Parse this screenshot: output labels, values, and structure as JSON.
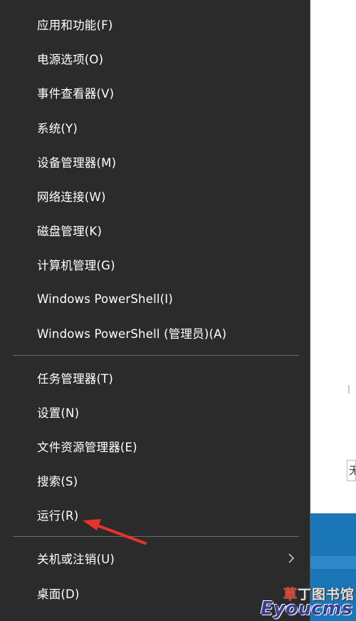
{
  "menu": {
    "items": [
      {
        "label": "应用和功能(F)"
      },
      {
        "label": "电源选项(O)"
      },
      {
        "label": "事件查看器(V)"
      },
      {
        "label": "系统(Y)"
      },
      {
        "label": "设备管理器(M)"
      },
      {
        "label": "网络连接(W)"
      },
      {
        "label": "磁盘管理(K)"
      },
      {
        "label": "计算机管理(G)"
      },
      {
        "label": "Windows PowerShell(I)"
      },
      {
        "label": "Windows PowerShell (管理员)(A)"
      },
      {
        "label": "任务管理器(T)"
      },
      {
        "label": "设置(N)"
      },
      {
        "label": "文件资源管理器(E)"
      },
      {
        "label": "搜索(S)"
      },
      {
        "label": "运行(R)"
      },
      {
        "label": "关机或注销(U)",
        "submenu": true
      },
      {
        "label": "桌面(D)"
      }
    ]
  },
  "background_window": {
    "field_text": "无"
  },
  "watermark": {
    "cn_part1": "草",
    "cn_part2": "丁图书馆",
    "en": "Eyoucms"
  },
  "colors": {
    "menu_bg": "#2b2b2b",
    "menu_text": "#ffffff",
    "separator": "#6a6a6a",
    "annotation_arrow": "#e8332a",
    "taskbar": "#1b76b8"
  }
}
